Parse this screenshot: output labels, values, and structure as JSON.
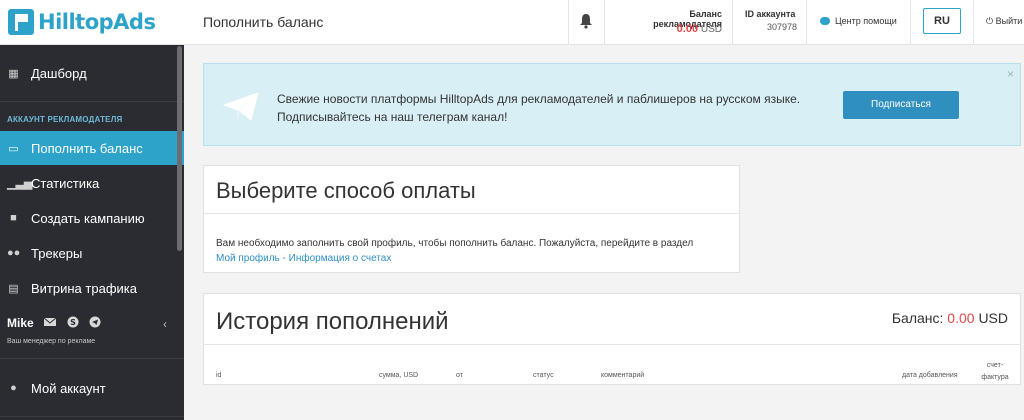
{
  "brand": {
    "name": "HilltopAds",
    "color": "#2ea3c9"
  },
  "sidebar": {
    "dashboard": "Дашборд",
    "section_title": "АККАУНТ РЕКЛАМОДАТЕЛЯ",
    "items": [
      {
        "label": "Пополнить баланс",
        "icon": "credit-card-icon",
        "active": true
      },
      {
        "label": "Статистика",
        "icon": "chart-icon"
      },
      {
        "label": "Создать кампанию",
        "icon": "briefcase-icon"
      },
      {
        "label": "Трекеры",
        "icon": "users-icon"
      },
      {
        "label": "Витрина трафика",
        "icon": "calculator-icon"
      }
    ],
    "manager": {
      "name": "Mike",
      "subtitle": "Ваш менеджер по рекламе"
    },
    "my_account": "Мой аккаунт"
  },
  "header": {
    "page_title": "Пополнить баланс",
    "balance_label": "Баланс рекламодателя",
    "balance_value": "0.00",
    "balance_currency": "USD",
    "account_label": "ID аккаунта",
    "account_id": "307978",
    "help": "Центр помощи",
    "lang": "RU",
    "logout": "Выйти"
  },
  "alert": {
    "line1": "Свежие новости платформы HilltopAds для рекламодателей и паблишеров на русском языке.",
    "line2": "Подписывайтесь на наш телеграм канал!",
    "button": "Подписаться",
    "close": "×"
  },
  "payment": {
    "title": "Выберите способ оплаты",
    "text": "Вам необходимо заполнить свой профиль, чтобы пополнить баланс. Пожалуйста, перейдите в раздел",
    "link": "Мой профиль - Информация о счетах"
  },
  "history": {
    "title": "История пополнений",
    "balance_label": "Баланс:",
    "balance_value": "0.00",
    "balance_currency": "USD",
    "columns": [
      "id",
      "сумма, USD",
      "от",
      "статус",
      "комментарий",
      "дата добавления",
      "счет-фактура"
    ]
  }
}
